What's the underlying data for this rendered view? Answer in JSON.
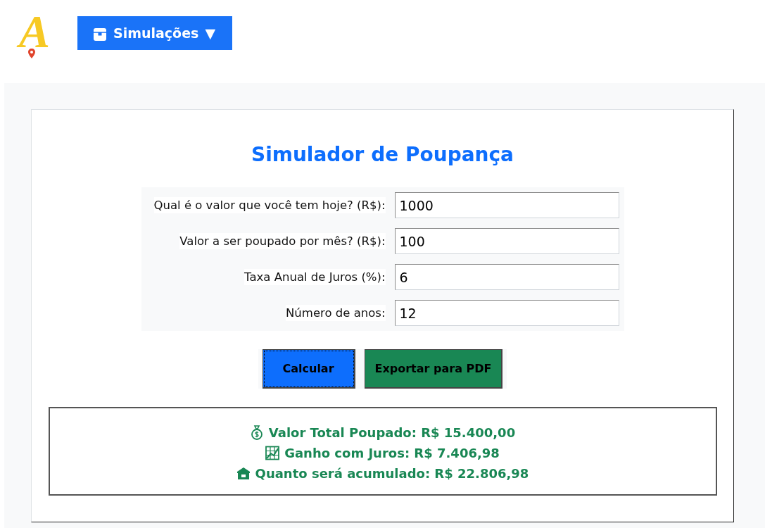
{
  "header": {
    "logo": {
      "letter": "A"
    },
    "menu_button": {
      "label": "Simulações",
      "caret": "▼"
    }
  },
  "title": "Simulador de Poupança",
  "fields": [
    {
      "label": "Qual é o valor que você tem hoje? (R$):",
      "value": "1000"
    },
    {
      "label": "Valor a ser poupado por mês? (R$):",
      "value": "100"
    },
    {
      "label": "Taxa Anual de Juros (%):",
      "value": "6"
    },
    {
      "label": "Número de anos:",
      "value": "12"
    }
  ],
  "buttons": [
    {
      "label": "Calcular",
      "kind": "primary",
      "focused": true
    },
    {
      "label": "Exportar para PDF",
      "kind": "success",
      "focused": false
    }
  ],
  "results": [
    {
      "kind": "money",
      "text": "Valor Total Poupado: R$ 15.400,00"
    },
    {
      "kind": "chart",
      "text": "Ganho com Juros: R$ 7.406,98"
    },
    {
      "kind": "bank",
      "text": "Quanto será acumulado: R$ 22.806,98"
    }
  ]
}
